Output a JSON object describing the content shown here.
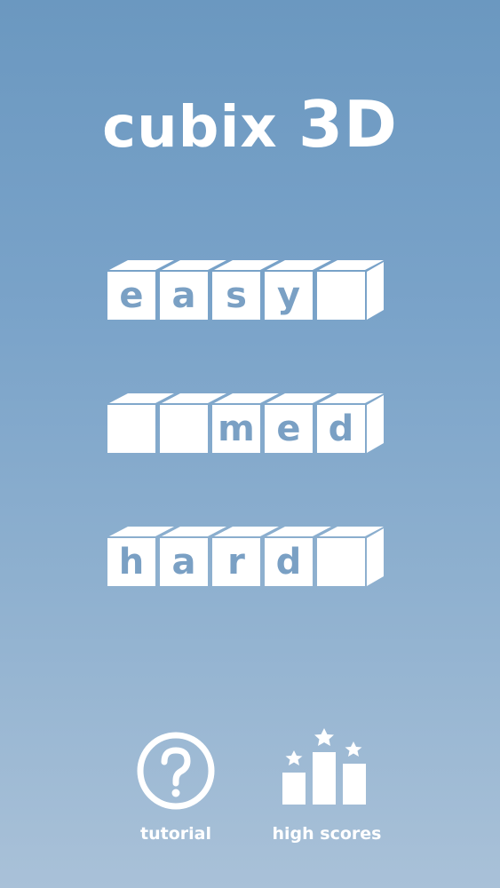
{
  "title": {
    "word": "cubix",
    "suffix": "3D"
  },
  "levels": [
    {
      "name": "easy",
      "tiles": [
        "e",
        "a",
        "s",
        "y",
        ""
      ]
    },
    {
      "name": "med",
      "tiles": [
        "",
        "",
        "m",
        "e",
        "d"
      ]
    },
    {
      "name": "hard",
      "tiles": [
        "h",
        "a",
        "r",
        "d",
        ""
      ]
    }
  ],
  "buttons": {
    "tutorial_label": "tutorial",
    "high_scores_label": "high scores"
  },
  "colors": {
    "tile_face": "#ffffff",
    "tile_text": "#7aa0c4",
    "background_top": "#6b98c0",
    "background_bottom": "#a9c1d8"
  }
}
